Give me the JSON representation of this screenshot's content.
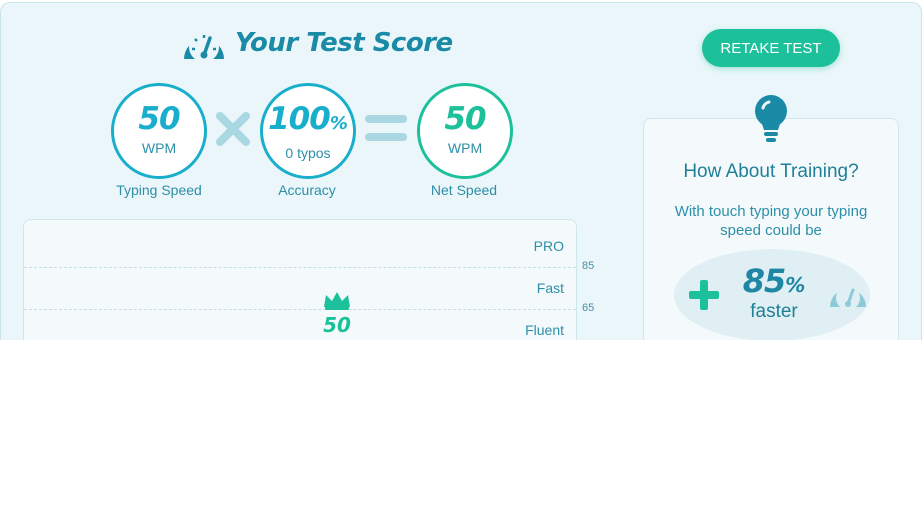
{
  "header": {
    "title": "Your Test Score",
    "retake_label": "RETAKE TEST"
  },
  "results": {
    "typing_speed": {
      "value": "50",
      "unit": "WPM",
      "caption": "Typing Speed"
    },
    "accuracy": {
      "value": "100",
      "suffix": "%",
      "unit": "0 typos",
      "caption": "Accuracy"
    },
    "net_speed": {
      "value": "50",
      "unit": "WPM",
      "caption": "Net Speed"
    }
  },
  "speed_chart": {
    "bands": [
      "PRO",
      "Fast",
      "Fluent"
    ],
    "thresholds": [
      "85",
      "65"
    ],
    "score": "50"
  },
  "training": {
    "heading": "How About Training?",
    "text": "With touch typing your typing speed could be",
    "gain_value": "85",
    "gain_suffix": "%",
    "gain_label": "faster"
  },
  "colors": {
    "accent_blue": "#19aecb",
    "accent_green": "#1cc09a",
    "panel_bg": "#eaf6f9"
  },
  "icons": [
    "speedometer-icon",
    "times-icon",
    "equals-icon",
    "crown-icon",
    "lightbulb-icon",
    "plus-icon"
  ]
}
